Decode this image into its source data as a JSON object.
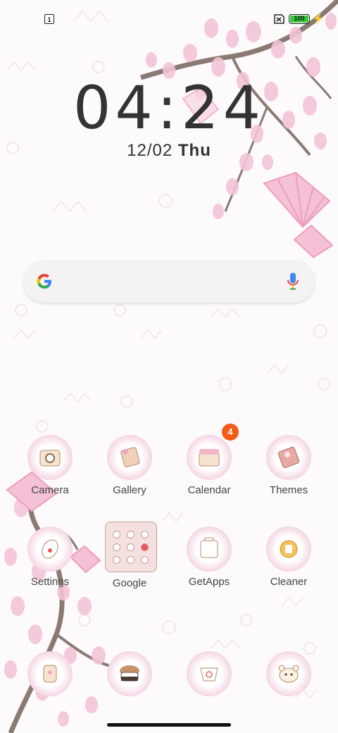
{
  "status_bar": {
    "notification_badge": "1",
    "battery_level": "100"
  },
  "lockscreen": {
    "time": "04:24",
    "date": "12/02",
    "weekday": "Thu"
  },
  "search_bar": {
    "logo": "google-g-icon",
    "mic": "microphone-icon"
  },
  "apps_row1": [
    {
      "label": "Camera",
      "icon": "camera-icon"
    },
    {
      "label": "Gallery",
      "icon": "gallery-icon"
    },
    {
      "label": "Calendar",
      "icon": "calendar-icon",
      "badge": "4"
    },
    {
      "label": "Themes",
      "icon": "themes-icon"
    }
  ],
  "apps_row2": [
    {
      "label": "Settings",
      "icon": "settings-icon"
    },
    {
      "label": "Google",
      "icon": "google-folder-icon"
    },
    {
      "label": "GetApps",
      "icon": "getapps-icon"
    },
    {
      "label": "Cleaner",
      "icon": "cleaner-icon"
    }
  ],
  "dock": [
    {
      "icon": "phone-icon"
    },
    {
      "icon": "messages-icon"
    },
    {
      "icon": "browser-icon"
    },
    {
      "icon": "bear-icon"
    }
  ],
  "colors": {
    "blossom": "#f3c4d8",
    "branch": "#8a7a73",
    "badge": "#f35b18",
    "battery": "#37c73b"
  }
}
